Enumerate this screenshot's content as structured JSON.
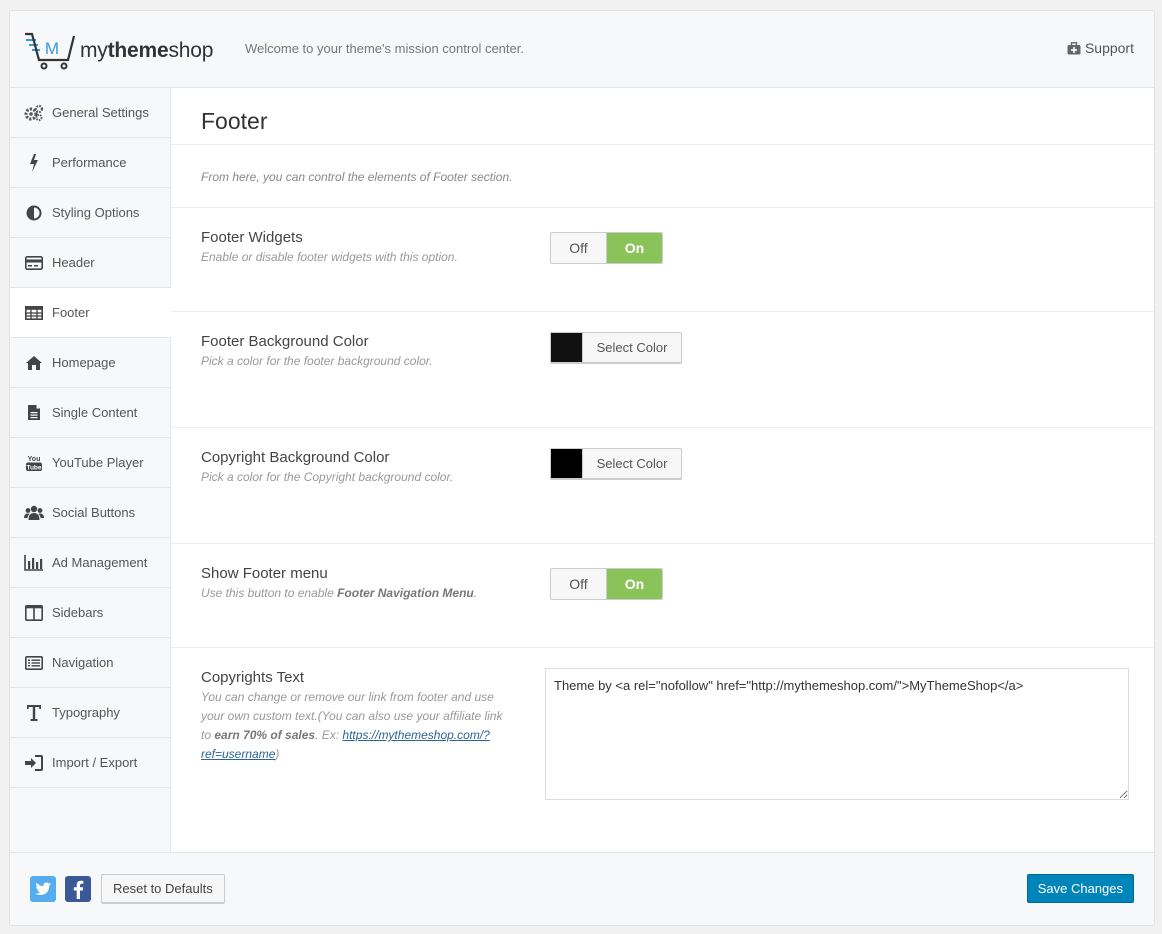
{
  "header": {
    "brand_prefix": "my",
    "brand_bold": "theme",
    "brand_suffix": "shop",
    "tagline": "Welcome to your theme's mission control center.",
    "support_label": "Support"
  },
  "sidebar": {
    "items": [
      {
        "label": "General Settings",
        "icon": "gears-icon"
      },
      {
        "label": "Performance",
        "icon": "bolt-icon"
      },
      {
        "label": "Styling Options",
        "icon": "contrast-icon"
      },
      {
        "label": "Header",
        "icon": "header-icon"
      },
      {
        "label": "Footer",
        "icon": "table-icon",
        "active": true
      },
      {
        "label": "Homepage",
        "icon": "home-icon"
      },
      {
        "label": "Single Content",
        "icon": "document-icon"
      },
      {
        "label": "YouTube Player",
        "icon": "youtube-icon"
      },
      {
        "label": "Social Buttons",
        "icon": "users-icon"
      },
      {
        "label": "Ad Management",
        "icon": "bar-chart-icon"
      },
      {
        "label": "Sidebars",
        "icon": "columns-icon"
      },
      {
        "label": "Navigation",
        "icon": "list-icon"
      },
      {
        "label": "Typography",
        "icon": "text-icon"
      },
      {
        "label": "Import / Export",
        "icon": "sign-in-icon"
      }
    ]
  },
  "main": {
    "title": "Footer",
    "intro": "From here, you can control the elements of Footer section.",
    "footer_widgets": {
      "title": "Footer Widgets",
      "desc": "Enable or disable footer widgets with this option.",
      "off_label": "Off",
      "on_label": "On",
      "value": "On"
    },
    "footer_bg": {
      "title": "Footer Background Color",
      "desc": "Pick a color for the footer background color.",
      "button_label": "Select Color",
      "color": "#111111"
    },
    "copyright_bg": {
      "title": "Copyright Background Color",
      "desc": "Pick a color for the Copyright background color.",
      "button_label": "Select Color",
      "color": "#000000"
    },
    "footer_menu": {
      "title": "Show Footer menu",
      "desc_prefix": "Use this button to enable ",
      "desc_bold": "Footer Navigation Menu",
      "desc_suffix": ".",
      "off_label": "Off",
      "on_label": "On",
      "value": "On"
    },
    "copyrights": {
      "title": "Copyrights Text",
      "desc_prefix": "You can change or remove our link from footer and use your own custom text.(You can also use your affiliate link to ",
      "desc_bold": "earn 70% of sales",
      "desc_middle": ". Ex: ",
      "desc_link": "https://mythemeshop.com/?ref=username",
      "desc_suffix": ")",
      "value": "Theme by <a rel=\"nofollow\" href=\"http://mythemeshop.com/\">MyThemeShop</a>"
    }
  },
  "footer": {
    "reset_label": "Reset to Defaults",
    "save_label": "Save Changes",
    "twitter_icon": "twitter-icon",
    "facebook_icon": "facebook-icon"
  },
  "colors": {
    "accent_green": "#8ac35a",
    "save_blue": "#0085ba",
    "logo_blue": "#3a9ad9"
  }
}
